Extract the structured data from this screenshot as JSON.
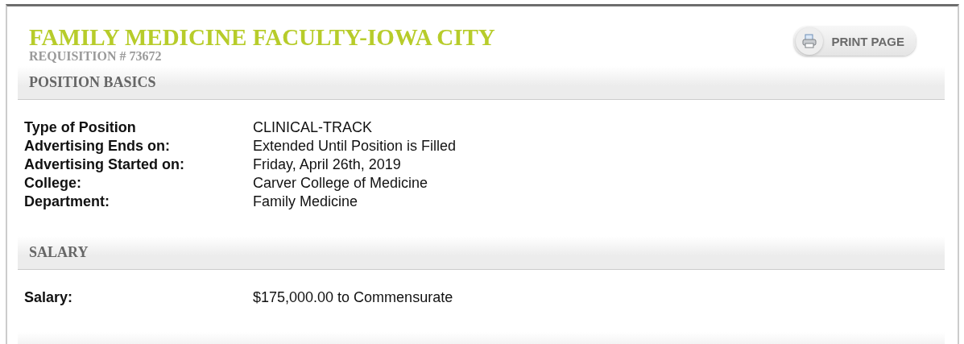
{
  "title": "FAMILY MEDICINE FACULTY-IOWA CITY",
  "requisition": "REQUISITION # 73672",
  "print_button": {
    "label": "PRINT PAGE"
  },
  "sections": [
    {
      "heading": "POSITION BASICS",
      "rows": [
        {
          "label": "Type of Position",
          "value": "CLINICAL-TRACK"
        },
        {
          "label": "Advertising Ends on:",
          "value": "Extended Until Position is Filled"
        },
        {
          "label": "Advertising Started on:",
          "value": "Friday, April 26th, 2019"
        },
        {
          "label": "College:",
          "value": "Carver College of Medicine"
        },
        {
          "label": "Department:",
          "value": "Family Medicine"
        }
      ]
    },
    {
      "heading": "SALARY",
      "rows": [
        {
          "label": "Salary:",
          "value": "$175,000.00 to Commensurate"
        }
      ]
    }
  ]
}
